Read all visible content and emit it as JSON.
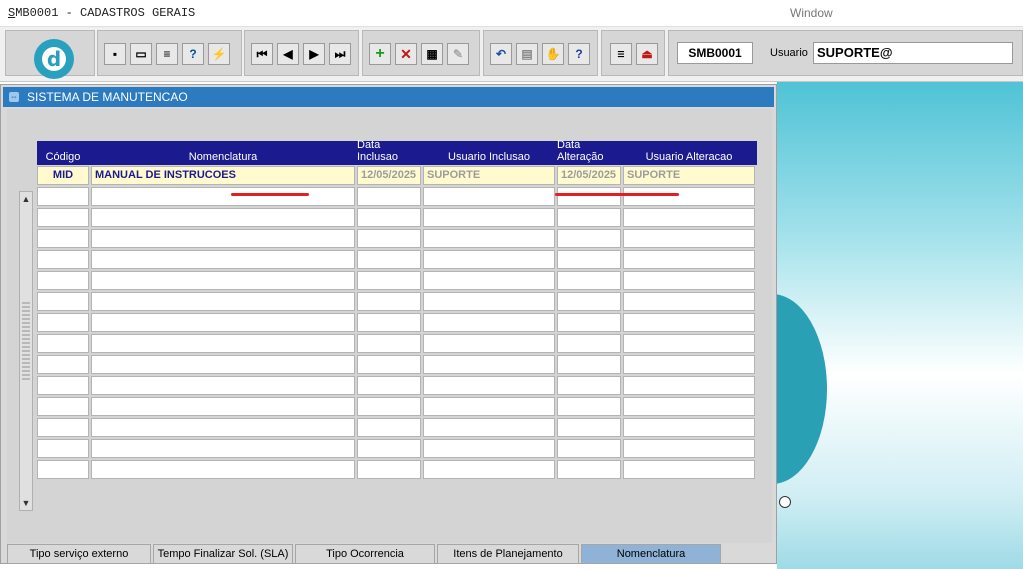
{
  "titlebar": {
    "title_first": "S",
    "title_rest": "MB0001 - CADASTROS GERAIS",
    "window_menu": "Window"
  },
  "toolbar": {
    "logo_letter": "d",
    "form_code": "SMB0001",
    "user_label": "Usuario",
    "user_value": "SUPORTE@"
  },
  "panel": {
    "title": "SISTEMA DE MANUTENCAO"
  },
  "grid": {
    "columns": [
      "Código",
      "Nomenclatura",
      "Data Inclusao",
      "Usuario Inclusao",
      "Data Alteração",
      "Usuario Alteracao"
    ],
    "rows": [
      {
        "codigo": "MID",
        "nomenclatura": "MANUAL DE INSTRUCOES",
        "data_inclusao": "12/05/2025",
        "usuario_inclusao": "SUPORTE",
        "data_alteracao": "12/05/2025",
        "usuario_alteracao": "SUPORTE"
      }
    ]
  },
  "tabs": [
    {
      "label": "Tipo serviço externo"
    },
    {
      "label": "Tempo Finalizar Sol. (SLA)"
    },
    {
      "label": "Tipo Ocorrencia"
    },
    {
      "label": "Itens de Planejamento"
    },
    {
      "label": "Nomenclatura"
    }
  ],
  "active_tab": "Nomenclatura",
  "colors": {
    "panel_header": "#2c7bc0",
    "grid_header": "#1b1b8f",
    "selected_row": "#fffbcf",
    "active_tab": "#8fb3d6",
    "annotation": "#e41f1f"
  }
}
